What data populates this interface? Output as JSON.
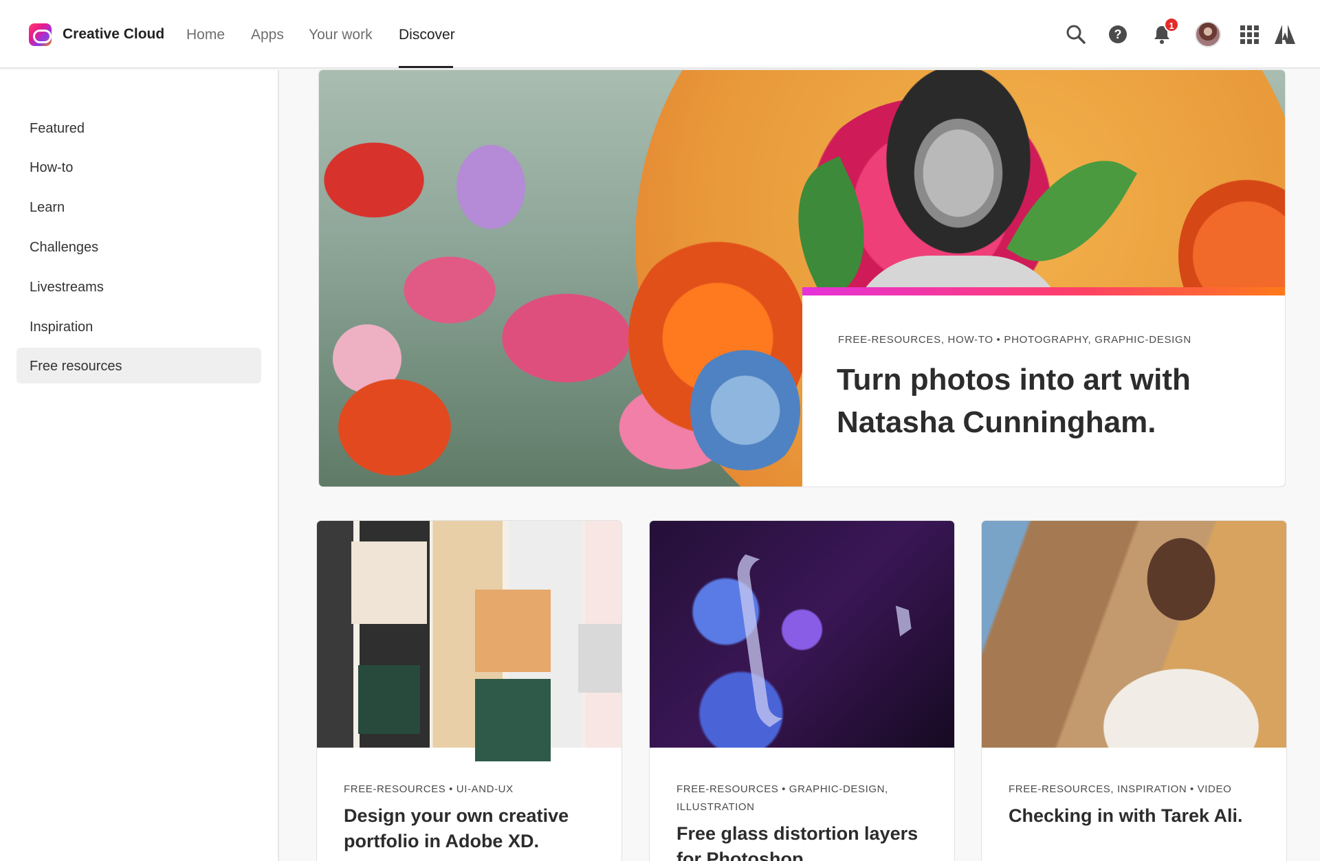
{
  "header": {
    "brand": "Creative Cloud",
    "nav": [
      "Home",
      "Apps",
      "Your work",
      "Discover"
    ],
    "active_nav": "Discover",
    "notification_count": "1",
    "icons": [
      "search-icon",
      "help-icon",
      "bell-icon",
      "avatar",
      "apps-grid-icon",
      "adobe-logo-icon"
    ]
  },
  "sidebar": {
    "items": [
      "Featured",
      "How-to",
      "Learn",
      "Challenges",
      "Livestreams",
      "Inspiration",
      "Free resources"
    ],
    "active": "Free resources"
  },
  "hero": {
    "tags": "FREE-RESOURCES, HOW-TO • PHOTOGRAPHY, GRAPHIC-DESIGN",
    "title": "Turn photos into art with Natasha Cunningham."
  },
  "cards": [
    {
      "tags": "FREE-RESOURCES • UI-AND-UX",
      "title": "Design your own creative portfolio in Adobe XD."
    },
    {
      "tags": "FREE-RESOURCES • GRAPHIC-DESIGN, ILLUSTRATION",
      "title": "Free glass distortion layers for Photoshop"
    },
    {
      "tags": "FREE-RESOURCES, INSPIRATION • VIDEO",
      "title": "Checking in with Tarek Ali."
    }
  ],
  "colors": {
    "accent_gradient": [
      "#e532d9",
      "#ff3d6b",
      "#ff7a1a"
    ],
    "badge": "#e22b2b"
  }
}
